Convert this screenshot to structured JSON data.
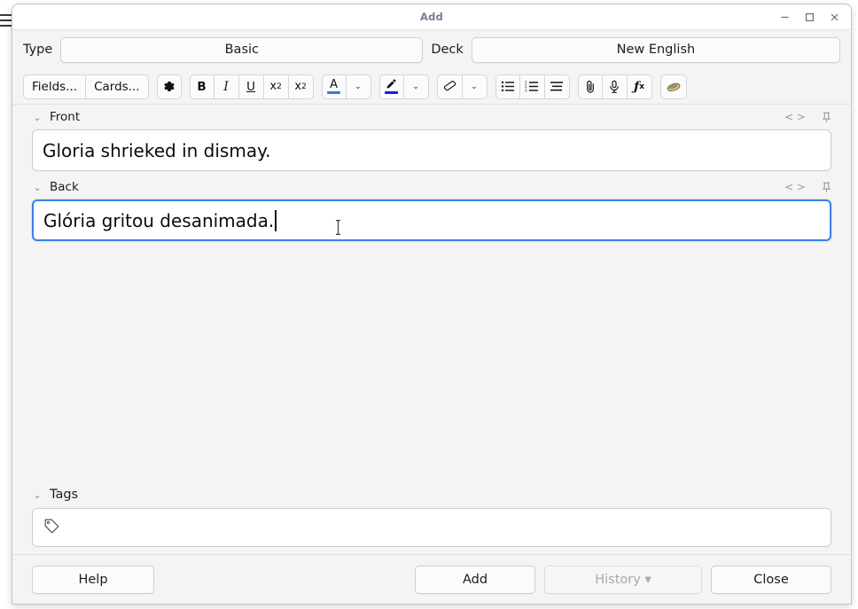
{
  "window": {
    "title": "Add",
    "controls": {
      "minimize": "minimize-icon",
      "maximize": "maximize-icon",
      "close": "close-icon"
    }
  },
  "notetype_row": {
    "type_label": "Type",
    "type_value": "Basic",
    "deck_label": "Deck",
    "deck_value": "New English"
  },
  "toolbar": {
    "fields_label": "Fields...",
    "cards_label": "Cards...",
    "settings_icon": "gear-icon",
    "bold_label": "B",
    "italic_label": "I",
    "underline_label": "U",
    "superscript_base": "x",
    "superscript_exp": "2",
    "subscript_base": "x",
    "subscript_exp": "2",
    "text_color_label": "A",
    "text_color_swatch": "#3f78d8",
    "text_color_chevron": "⌄",
    "highlight_icon": "marker-pen-icon",
    "highlight_swatch": "#1818ee",
    "highlight_chevron": "⌄",
    "eraser_icon": "eraser-icon",
    "eraser_chevron": "⌄",
    "bullet_list_icon": "unordered-list-icon",
    "numbered_list_icon": "ordered-list-icon",
    "justify_icon": "text-align-icon",
    "attach_icon": "paperclip-icon",
    "record_icon": "microphone-icon",
    "mathjax_label": "ƒ",
    "mathjax_sub": "x",
    "cloze_icon": "cloze-bracket-icon"
  },
  "fields": [
    {
      "name": "Front",
      "value": "Gloria shrieked in dismay.",
      "chevron": "⌄",
      "html_icon": "< >",
      "pin_icon": "pin-icon",
      "focused": false
    },
    {
      "name": "Back",
      "value": "Glória gritou desanimada.",
      "chevron": "⌄",
      "html_icon": "< >",
      "pin_icon": "pin-icon",
      "focused": true
    }
  ],
  "tags": {
    "label": "Tags",
    "chevron": "⌄",
    "icon": "tag-icon",
    "value": "",
    "placeholder": ""
  },
  "footer": {
    "help_label": "Help",
    "add_label": "Add",
    "history_label": "History ▾",
    "history_disabled": true,
    "close_label": "Close"
  },
  "colors": {
    "focus_border": "#3a80e8",
    "window_bg": "#f4f4f4",
    "field_bg": "#ffffff",
    "title_text": "#767f93"
  }
}
